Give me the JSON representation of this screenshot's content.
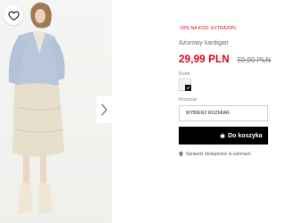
{
  "product": {
    "promo_text": "-20% NA KOD: EXTRA20PL",
    "name": "Ażurowy kardigan",
    "price_new": "29,99 PLN",
    "price_old": "59,99 PLN"
  },
  "variants": {
    "color_label": "Kolor",
    "size_label": "Rozmiar",
    "size_placeholder": "WYBIERZ ROZMIAR"
  },
  "actions": {
    "add_to_cart_label": "Do koszyka",
    "check_stores_label": "Sprawdź dostępność w salonach"
  },
  "colors": {
    "accent_red": "#e2001a",
    "button_black": "#000000"
  }
}
